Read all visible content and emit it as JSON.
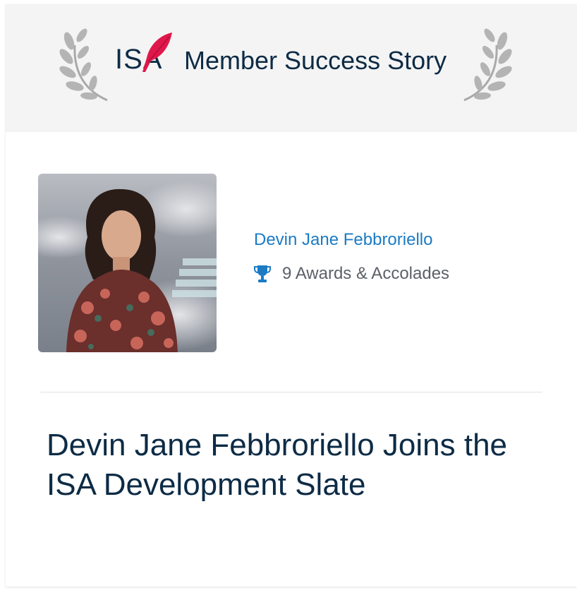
{
  "banner": {
    "logo_text": "ISA",
    "title": "Member Success Story",
    "background": "#f4f4f4",
    "logo_accent_color": "#e0174a"
  },
  "member": {
    "name": "Devin Jane Febbroriello",
    "name_color": "#1b7bc4",
    "awards_label": "9 Awards & Accolades",
    "awards_icon": "trophy-icon"
  },
  "story": {
    "headline": "Devin Jane Febbroriello Joins the ISA Development Slate"
  }
}
